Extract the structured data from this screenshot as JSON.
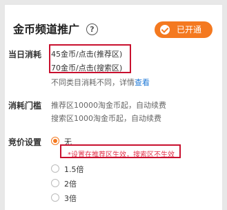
{
  "header": {
    "title": "金币频道推广",
    "help_icon": "question-circle-icon",
    "status_badge": {
      "label": "已开通",
      "icon": "check-circle-icon",
      "color": "#f47920"
    }
  },
  "daily_cost": {
    "label": "当日消耗",
    "recommend_rate": "45金币/点击(推荐区)",
    "search_rate": "70金币/点击(搜索区)",
    "note_text": "不同类目消耗不同，详情",
    "note_link": "查看"
  },
  "threshold": {
    "label": "消耗门槛",
    "line1": "推荐区10000淘金币起，自动续费",
    "line2": "搜索区1000淘金币起，自动续费"
  },
  "bid": {
    "label": "竞价设置",
    "options": [
      {
        "label": "无",
        "selected": true
      },
      {
        "label": "1.5倍",
        "selected": false
      },
      {
        "label": "2倍",
        "selected": false
      },
      {
        "label": "3倍",
        "selected": false
      }
    ],
    "note": "*设置在推荐区生效，搜索区不生效"
  },
  "colors": {
    "accent": "#f47920",
    "highlight": "#c8102e",
    "link": "#1e78d6"
  }
}
